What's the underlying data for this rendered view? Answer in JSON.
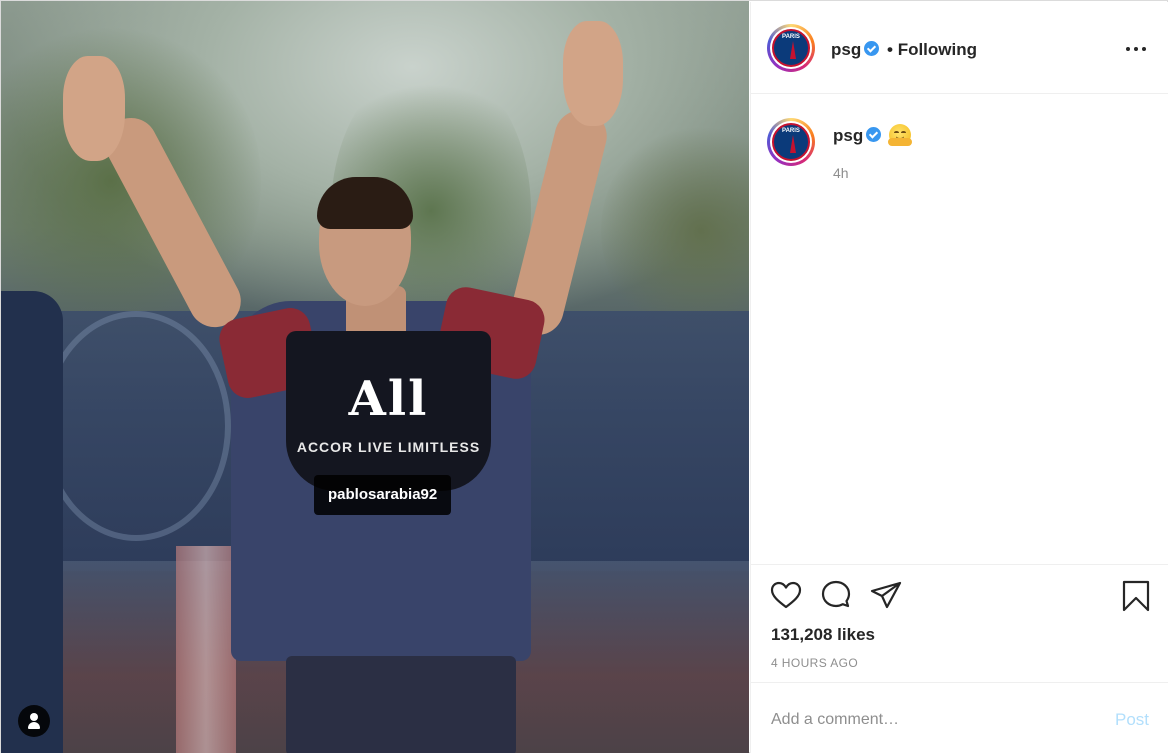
{
  "photo": {
    "tag_username": "pablosarabia92",
    "shirt_sponsor_logo": "All",
    "shirt_sponsor_text": "ACCOR LIVE LIMITLESS"
  },
  "header": {
    "username": "psg",
    "separator": "•",
    "follow_label": "Following"
  },
  "caption": {
    "username": "psg",
    "emoji_icon": "hugging-face-emoji",
    "time": "4h"
  },
  "actions": {
    "likes": "131,208 likes",
    "time_ago": "4 HOURS AGO"
  },
  "comment": {
    "placeholder": "Add a comment…",
    "post_label": "Post"
  },
  "colors": {
    "verified": "#3897f0",
    "post_disabled": "#b2dffc",
    "secondary_text": "#8e8e8e"
  }
}
